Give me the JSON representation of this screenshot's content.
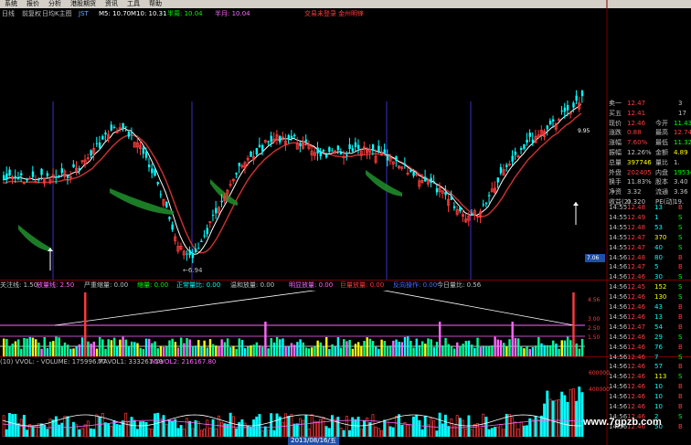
{
  "menubar": {
    "items": [
      "系统",
      "报价",
      "分析",
      "港股期货",
      "资讯",
      "工具",
      "帮助"
    ]
  },
  "header": {
    "period": "日线",
    "adjust": "前复权",
    "view": "日均K主图",
    "indicator": "JST",
    "ma5": "M5: 10.70",
    "ma10": "M10: 10.31",
    "halfweek": "半周: 10.04",
    "halfmonth": "半月: 10.04",
    "ad_login": "交易未登录",
    "ad_site": "金州明锋"
  },
  "main_chart": {
    "low_mark": "6.94",
    "price_tag": "7.06",
    "high_axis": [
      "10.00",
      "10.00",
      "10.0"
    ],
    "mid_axis": [
      "9.95"
    ]
  },
  "volume_indicator": {
    "labels": [
      {
        "text": "关注线: 1.50",
        "color": "#c0c0c0"
      },
      {
        "text": "放量线: 2.50",
        "color": "#ff66ff"
      },
      {
        "text": "严重缩量: 0.00",
        "color": "#c0c0c0"
      },
      {
        "text": "缩量: 0.00",
        "color": "#00ff00"
      },
      {
        "text": "正常量比: 0.00",
        "color": "#00ffff"
      },
      {
        "text": "温和放量: 0.00",
        "color": "#c0c0c0"
      },
      {
        "text": "明显放量: 0.00",
        "color": "#ff66ff"
      },
      {
        "text": "巨量放量: 0.00",
        "color": "#ff3b3b"
      },
      {
        "text": "反向操作: 0.00",
        "color": "#4a6cff"
      },
      {
        "text": "今日量比: 0.56",
        "color": "#c0c0c0"
      }
    ],
    "axis": [
      "4.56",
      "3.00",
      "2.50",
      "1.50"
    ]
  },
  "vvol": {
    "labels": [
      {
        "text": "(10) VVOL: - VOLUME: 175996.77",
        "color": "#c0c0c0"
      },
      {
        "text": "MAVOL1: 333261.19",
        "color": "#c0c0c0"
      },
      {
        "text": "MAVOL2: 216167.80",
        "color": "#ff66ff"
      }
    ],
    "axis": [
      "600000",
      "400000"
    ]
  },
  "date_label": "2013/08/16/五",
  "quote": {
    "rows": [
      {
        "l": "卖一",
        "v": "12.47",
        "c": "#ff3b3b",
        "r": "3"
      },
      {
        "l": "买五",
        "v": "12.41",
        "c": "#ff3b3b",
        "r": "17"
      },
      {
        "l": "现价",
        "v": "12.46",
        "c": "#ff3b3b",
        "r2l": "今开",
        "r2": "11.43",
        "r2c": "#00ff00"
      },
      {
        "l": "涨跌",
        "v": "0.88",
        "c": "#ff3b3b",
        "r2l": "最高",
        "r2": "12.74",
        "r2c": "#ff3b3b"
      },
      {
        "l": "涨幅",
        "v": "7.60%",
        "c": "#ff3b3b",
        "r2l": "最低",
        "r2": "11.32",
        "r2c": "#00ff00"
      },
      {
        "l": "振幅",
        "v": "12.26%",
        "c": "#c0c0c0",
        "r2l": "金额",
        "r2": "4.89",
        "r2c": "#ffff00"
      },
      {
        "l": "总量",
        "v": "397746",
        "c": "#ffff00",
        "r2l": "量比",
        "r2": "1.",
        "r2c": "#c0c0c0"
      },
      {
        "l": "外盘",
        "v": "202405",
        "c": "#ff3b3b",
        "r2l": "内盘",
        "r2": "195341",
        "r2c": "#00ff00"
      },
      {
        "l": "换手",
        "v": "11.83%",
        "c": "#c0c0c0",
        "r2l": "股本",
        "r2": "3.40",
        "r2c": "#c0c0c0"
      },
      {
        "l": "净资",
        "v": "3.32",
        "c": "#c0c0c0",
        "r2l": "流通",
        "r2": "3.36",
        "r2c": "#c0c0c0"
      },
      {
        "l": "收益(2)",
        "v": "0.320",
        "c": "#c0c0c0",
        "r2l": "PE(动)",
        "r2": "19.",
        "r2c": "#c0c0c0"
      }
    ]
  },
  "ticks": [
    {
      "t": "14:55",
      "p": "12.48",
      "pc": "#ff3b3b",
      "v": "13",
      "vc": "#00ffff",
      "s": "B",
      "sc": "#ff3b3b"
    },
    {
      "t": "14:55",
      "p": "12.49",
      "pc": "#ff3b3b",
      "v": "1",
      "vc": "#00ffff",
      "s": "S",
      "sc": "#00ff00"
    },
    {
      "t": "14:55",
      "p": "12.48",
      "pc": "#ff3b3b",
      "v": "53",
      "vc": "#00ffff",
      "s": "S",
      "sc": "#00ff00"
    },
    {
      "t": "14:55",
      "p": "12.47",
      "pc": "#ff3b3b",
      "v": "370",
      "vc": "#ffff00",
      "s": "S",
      "sc": "#00ff00"
    },
    {
      "t": "14:55",
      "p": "12.47",
      "pc": "#ff3b3b",
      "v": "40",
      "vc": "#00ffff",
      "s": "S",
      "sc": "#00ff00"
    },
    {
      "t": "14:56",
      "p": "12.48",
      "pc": "#ff3b3b",
      "v": "80",
      "vc": "#00ffff",
      "s": "B",
      "sc": "#ff3b3b"
    },
    {
      "t": "14:56",
      "p": "12.47",
      "pc": "#ff3b3b",
      "v": "5",
      "vc": "#00ffff",
      "s": "B",
      "sc": "#ff3b3b"
    },
    {
      "t": "14:56",
      "p": "12.46",
      "pc": "#ff3b3b",
      "v": "30",
      "vc": "#00ffff",
      "s": "S",
      "sc": "#00ff00"
    },
    {
      "t": "14:56",
      "p": "12.45",
      "pc": "#ff3b3b",
      "v": "152",
      "vc": "#ffff00",
      "s": "S",
      "sc": "#00ff00"
    },
    {
      "t": "14:56",
      "p": "12.46",
      "pc": "#ff3b3b",
      "v": "130",
      "vc": "#ffff00",
      "s": "S",
      "sc": "#00ff00"
    },
    {
      "t": "14:56",
      "p": "12.46",
      "pc": "#ff3b3b",
      "v": "43",
      "vc": "#00ffff",
      "s": "B",
      "sc": "#ff3b3b"
    },
    {
      "t": "14:56",
      "p": "12.46",
      "pc": "#ff3b3b",
      "v": "13",
      "vc": "#00ffff",
      "s": "B",
      "sc": "#ff3b3b"
    },
    {
      "t": "14:56",
      "p": "12.47",
      "pc": "#ff3b3b",
      "v": "54",
      "vc": "#00ffff",
      "s": "B",
      "sc": "#ff3b3b"
    },
    {
      "t": "14:56",
      "p": "12.46",
      "pc": "#ff3b3b",
      "v": "29",
      "vc": "#00ffff",
      "s": "S",
      "sc": "#00ff00"
    },
    {
      "t": "14:56",
      "p": "12.46",
      "pc": "#ff3b3b",
      "v": "76",
      "vc": "#00ffff",
      "s": "B",
      "sc": "#ff3b3b"
    },
    {
      "t": "14:56",
      "p": "12.46",
      "pc": "#ff3b3b",
      "v": "7",
      "vc": "#00ffff",
      "s": "S",
      "sc": "#00ff00"
    },
    {
      "t": "14:56",
      "p": "12.46",
      "pc": "#ff3b3b",
      "v": "57",
      "vc": "#00ffff",
      "s": "B",
      "sc": "#ff3b3b"
    },
    {
      "t": "14:56",
      "p": "12.46",
      "pc": "#ff3b3b",
      "v": "113",
      "vc": "#ffff00",
      "s": "S",
      "sc": "#00ff00"
    },
    {
      "t": "14:56",
      "p": "12.46",
      "pc": "#ff3b3b",
      "v": "10",
      "vc": "#00ffff",
      "s": "B",
      "sc": "#ff3b3b"
    },
    {
      "t": "14:56",
      "p": "12.46",
      "pc": "#ff3b3b",
      "v": "10",
      "vc": "#00ffff",
      "s": "B",
      "sc": "#ff3b3b"
    },
    {
      "t": "14:56",
      "p": "12.46",
      "pc": "#ff3b3b",
      "v": "10",
      "vc": "#00ffff",
      "s": "B",
      "sc": "#ff3b3b"
    },
    {
      "t": "14:56",
      "p": "12.46",
      "pc": "#ff3b3b",
      "v": "2",
      "vc": "#00ffff",
      "s": "S",
      "sc": "#00ff00"
    },
    {
      "t": "14:56",
      "p": "12.46",
      "pc": "#ff3b3b",
      "v": "50",
      "vc": "#00ffff",
      "s": "B",
      "sc": "#ff3b3b"
    }
  ],
  "watermark": "www.7gpzb.com",
  "colors": {
    "up": "#ff3b3b",
    "down": "#00ffff",
    "ma": "#ffffff",
    "band": "#1f8a2a"
  }
}
